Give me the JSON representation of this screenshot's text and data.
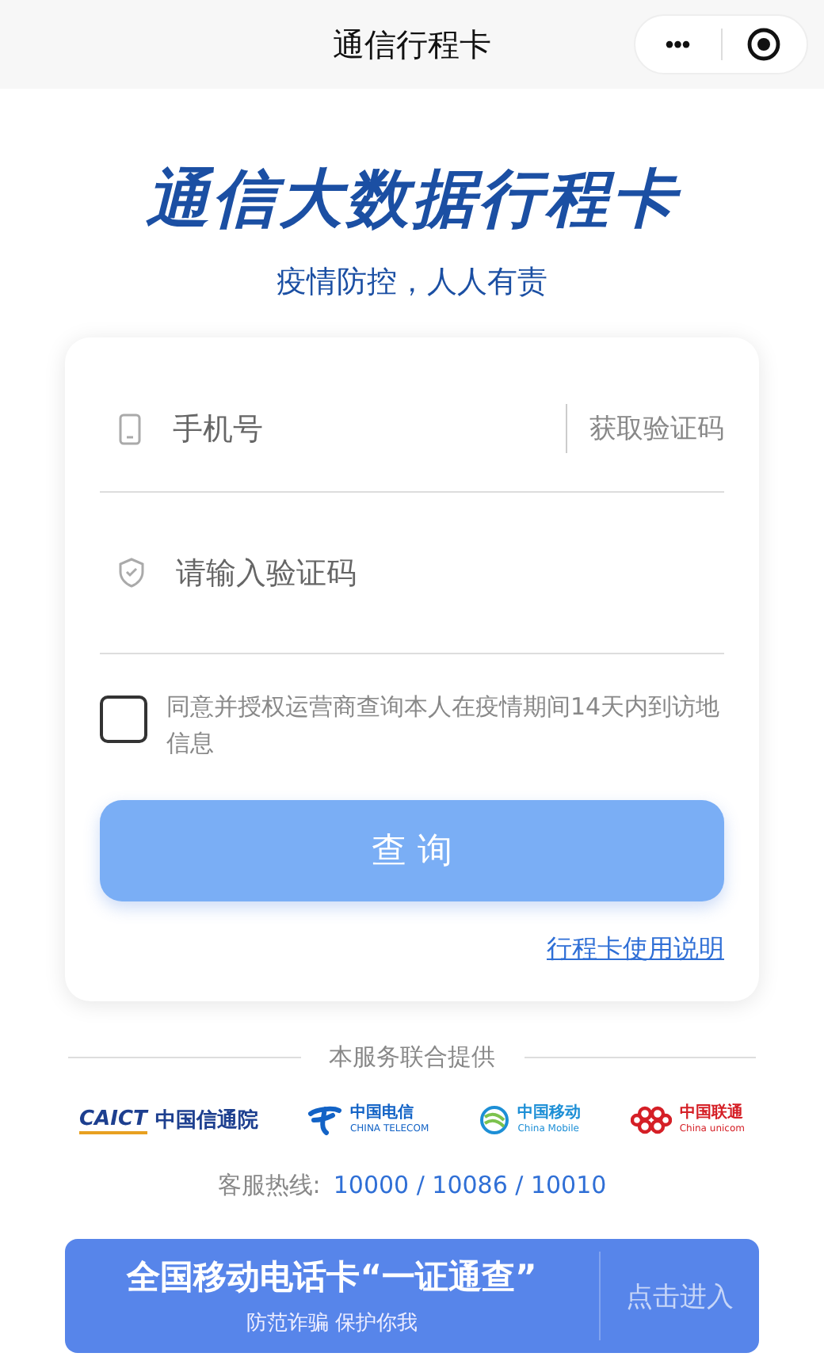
{
  "nav_bar": {
    "title": "通信行程卡",
    "more": "•••"
  },
  "header": {
    "title": "通信大数据行程卡",
    "subtitle": "疫情防控，人人有责"
  },
  "form": {
    "phone": {
      "placeholder": "手机号",
      "action": "获取验证码"
    },
    "code": {
      "placeholder": "请输入验证码"
    },
    "consent": {
      "checked": false,
      "text": "同意并授权运营商查询本人在疫情期间14天内到访地信息"
    },
    "submit": "查 询",
    "help_link": "行程卡使用说明"
  },
  "providers": {
    "heading": "本服务联合提供",
    "logos": [
      {
        "kind": "caict",
        "mark": "CAICT",
        "name": "中国信通院"
      },
      {
        "kind": "telecom",
        "name": "中国电信",
        "sub": "CHINA TELECOM"
      },
      {
        "kind": "mobile",
        "name": "中国移动",
        "sub": "China Mobile"
      },
      {
        "kind": "unicom",
        "name": "中国联通",
        "sub": "China unicom"
      }
    ],
    "hotline_label": "客服热线:",
    "hotline_numbers": "10000 / 10086 / 10010"
  },
  "banner": {
    "title": "全国移动电话卡“一证通查”",
    "subtitle": "防范诈骗 保护你我",
    "action": "点击进入"
  }
}
